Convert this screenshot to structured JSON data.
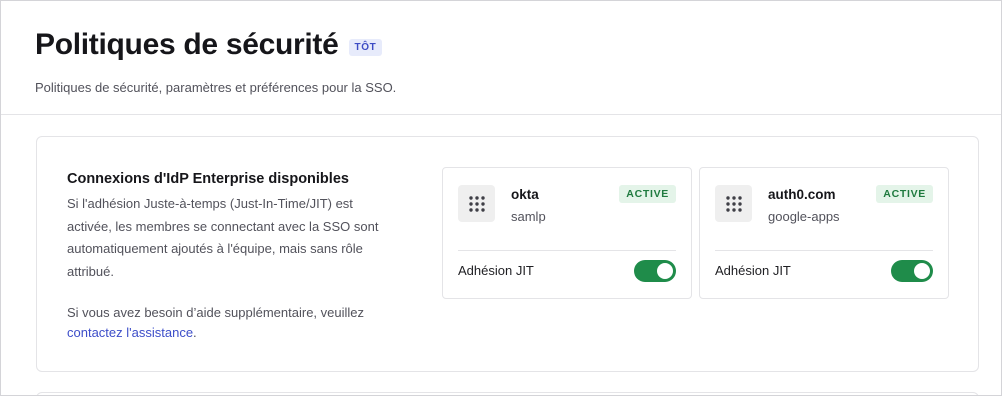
{
  "header": {
    "title": "Politiques de sécurité",
    "badge": "TÔT",
    "subtitle": "Politiques de sécurité, paramètres et préférences pour la SSO."
  },
  "enterprise": {
    "title": "Connexions d'IdP Enterprise disponibles",
    "description": "Si l'adhésion Juste-à-temps (Just-In-Time/JIT) est activée, les membres se connectant avec la SSO sont automatiquement ajoutés à l'équipe, mais sans rôle attribué.",
    "help_text": "Si vous avez besoin d’aide supplémentaire, veuillez",
    "help_link": "contactez l'assistance",
    "help_suffix": "."
  },
  "connections": [
    {
      "name": "okta",
      "type": "samlp",
      "status": "ACTIVE",
      "jit_label": "Adhésion JIT",
      "jit_enabled": true,
      "icon": "grid-dots-icon"
    },
    {
      "name": "auth0.com",
      "type": "google-apps",
      "status": "ACTIVE",
      "jit_label": "Adhésion JIT",
      "jit_enabled": true,
      "icon": "grid-dots-icon"
    }
  ],
  "colors": {
    "accent_link": "#3d4ec9",
    "toggle_on": "#1f8c4a",
    "status_active_bg": "#e4f4e9",
    "status_active_text": "#1f7a3f",
    "badge_bg": "#e7ebfb",
    "badge_text": "#3d4cc4"
  }
}
